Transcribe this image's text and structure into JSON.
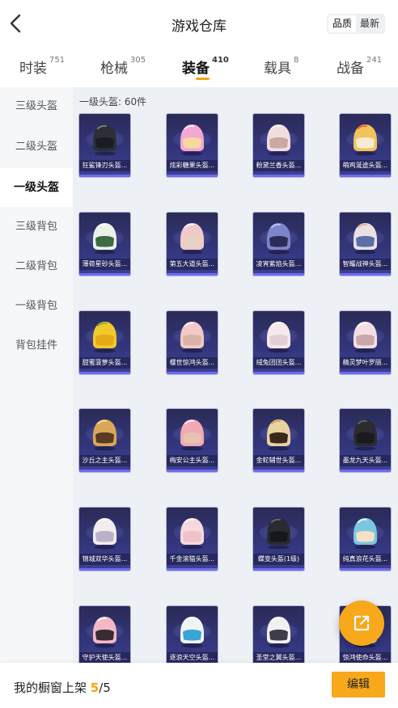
{
  "header": {
    "title": "游戏仓库",
    "sort_options": [
      "品质",
      "最新"
    ]
  },
  "tabs": [
    {
      "label": "时装",
      "count": "751",
      "active": false
    },
    {
      "label": "枪械",
      "count": "305",
      "active": false
    },
    {
      "label": "装备",
      "count": "410",
      "active": true
    },
    {
      "label": "载具",
      "count": "8",
      "active": false
    },
    {
      "label": "战备",
      "count": "241",
      "active": false
    }
  ],
  "sidebar": {
    "items": [
      "三级头盔",
      "二级头盔",
      "一级头盔",
      "三级背包",
      "二级背包",
      "一级背包",
      "背包挂件"
    ],
    "active": "一级头盔"
  },
  "section": {
    "title": "一级头盔: 60件"
  },
  "items": [
    {
      "name": "狂鲨锋刃头盔...",
      "shell": "#2d2f36",
      "visor": "#1a1c24",
      "trim": "#8a8f99"
    },
    {
      "name": "炫彩糖果头盔...",
      "shell": "#f3a7d2",
      "visor": "#f6d9a0",
      "trim": "#ffffff"
    },
    {
      "name": "粉黛兰香头盔...",
      "shell": "#f0dede",
      "visor": "#caa9a0",
      "trim": "#fff4f4"
    },
    {
      "name": "萌鸡涎途头盔...",
      "shell": "#f2c35a",
      "visor": "#f7ecd0",
      "trim": "#e84a3a"
    },
    {
      "name": "薄荷星砂头盔...",
      "shell": "#eaf2ea",
      "visor": "#3f6b44",
      "trim": "#ffffff"
    },
    {
      "name": "第五大道头盔...",
      "shell": "#f0c9cc",
      "visor": "#e9d2c2",
      "trim": "#ffffff"
    },
    {
      "name": "凌宵紫焰头盔...",
      "shell": "#7e86c9",
      "visor": "#2b2d57",
      "trim": "#c9d2ff"
    },
    {
      "name": "智耀战神头盔...",
      "shell": "#e9e1e3",
      "visor": "#5a6ea8",
      "trim": "#d9b27c"
    },
    {
      "name": "甜蜜菠萝头盔...",
      "shell": "#f2c92a",
      "visor": "#e4aa18",
      "trim": "#62a13a"
    },
    {
      "name": "樱世惊鸿头盔...",
      "shell": "#f2c9c5",
      "visor": "#d9b3a5",
      "trim": "#ffffff"
    },
    {
      "name": "绒兔团团头盔...",
      "shell": "#f6e9ec",
      "visor": "#e5cfd6",
      "trim": "#ffffff"
    },
    {
      "name": "精灵梦叶罗丽...",
      "shell": "#f3dfe3",
      "visor": "#caa7a8",
      "trim": "#ffffff"
    },
    {
      "name": "沙丘之主头盔...",
      "shell": "#d9a757",
      "visor": "#5a3a24",
      "trim": "#f3e2b8"
    },
    {
      "name": "梅安公主头盔...",
      "shell": "#f2a8b5",
      "visor": "#e6c2b0",
      "trim": "#ffffff"
    },
    {
      "name": "金蛇辅世头盔...",
      "shell": "#e8d2a0",
      "visor": "#3b2a1c",
      "trim": "#c9963b"
    },
    {
      "name": "墨龙九天头盔...",
      "shell": "#2c2c30",
      "visor": "#1b1b1e",
      "trim": "#6f6f75"
    },
    {
      "name": "锦城双华头盔...",
      "shell": "#f2ecef",
      "visor": "#b9b2c9",
      "trim": "#ffffff"
    },
    {
      "name": "千金滚猫头盔...",
      "shell": "#f6d8de",
      "visor": "#efc1c9",
      "trim": "#ffffff"
    },
    {
      "name": "蝶变头盔(1级)",
      "shell": "#2a2b30",
      "visor": "#16171b",
      "trim": "#73757d"
    },
    {
      "name": "纯真浪花头盔...",
      "shell": "#7cc6df",
      "visor": "#f1e1c5",
      "trim": "#ffffff"
    },
    {
      "name": "守护天使头盔...",
      "shell": "#f2b8c6",
      "visor": "#3a2b33",
      "trim": "#ffffff"
    },
    {
      "name": "逐浪天空头盔...",
      "shell": "#eef4f7",
      "visor": "#3aa4d6",
      "trim": "#ffffff"
    },
    {
      "name": "圣堂之翼头盔...",
      "shell": "#f2f0f3",
      "visor": "#3f3d4a",
      "trim": "#ffffff"
    },
    {
      "name": "惊鸿使命头盔...",
      "shell": "#d9d9de",
      "visor": "#8a8a95",
      "trim": "#ffffff"
    }
  ],
  "bottom": {
    "label": "我的橱窗上架",
    "current": "5",
    "total": "/5",
    "edit_label": "编辑"
  },
  "colors": {
    "accent": "#f7a81b",
    "card_bg": "#33357a",
    "card_bar": "#6e6cf0"
  },
  "icons": {
    "back": "chevron-left-icon",
    "share": "share-external-icon"
  }
}
